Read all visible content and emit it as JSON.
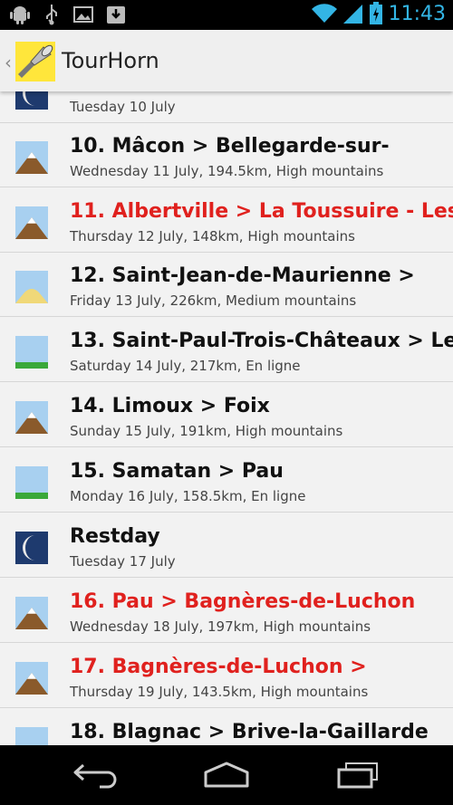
{
  "status_bar": {
    "time": "11:43",
    "left_icons": [
      "android-icon",
      "usb-icon",
      "image-icon",
      "download-icon"
    ],
    "right_icons": [
      "wifi-icon",
      "signal-icon",
      "battery-icon"
    ]
  },
  "action_bar": {
    "title": "TourHorn",
    "icon": "horn-icon"
  },
  "stages": [
    {
      "title": "",
      "subtitle": "Tuesday 10 July",
      "icon": "night",
      "highlight": false
    },
    {
      "title": "10. Mâcon > Bellegarde-sur-",
      "subtitle": "Wednesday 11 July, 194.5km, High mountains",
      "icon": "mountain",
      "highlight": false
    },
    {
      "title": "11. Albertville > La Toussuire - Les",
      "subtitle": "Thursday 12 July, 148km, High mountains",
      "icon": "mountain",
      "highlight": true
    },
    {
      "title": "12. Saint-Jean-de-Maurienne >",
      "subtitle": "Friday 13 July, 226km, Medium mountains",
      "icon": "hills",
      "highlight": false
    },
    {
      "title": "13. Saint-Paul-Trois-Châteaux > Le",
      "subtitle": "Saturday 14 July, 217km, En ligne",
      "icon": "flat",
      "highlight": false
    },
    {
      "title": "14. Limoux > Foix",
      "subtitle": "Sunday 15 July, 191km, High mountains",
      "icon": "mountain",
      "highlight": false
    },
    {
      "title": "15. Samatan > Pau",
      "subtitle": "Monday 16 July, 158.5km, En ligne",
      "icon": "flat",
      "highlight": false
    },
    {
      "title": "Restday",
      "subtitle": "Tuesday 17 July",
      "icon": "night",
      "highlight": false
    },
    {
      "title": "16. Pau > Bagnères-de-Luchon",
      "subtitle": "Wednesday 18 July, 197km, High mountains",
      "icon": "mountain",
      "highlight": true
    },
    {
      "title": "17. Bagnères-de-Luchon >",
      "subtitle": "Thursday 19 July, 143.5km, High mountains",
      "icon": "mountain",
      "highlight": true
    },
    {
      "title": "18. Blagnac > Brive-la-Gaillarde",
      "subtitle": "",
      "icon": "flat",
      "highlight": false
    }
  ],
  "colors": {
    "highlight": "#e0211e",
    "clock": "#33b5e5",
    "sky": "#a8d0f0",
    "mountain": "#8a5a2b",
    "hills": "#f0d878",
    "flat": "#3aa83a",
    "night": "#1e3a6e"
  },
  "nav_bar": {
    "buttons": [
      "back-icon",
      "home-icon",
      "recent-apps-icon"
    ]
  }
}
